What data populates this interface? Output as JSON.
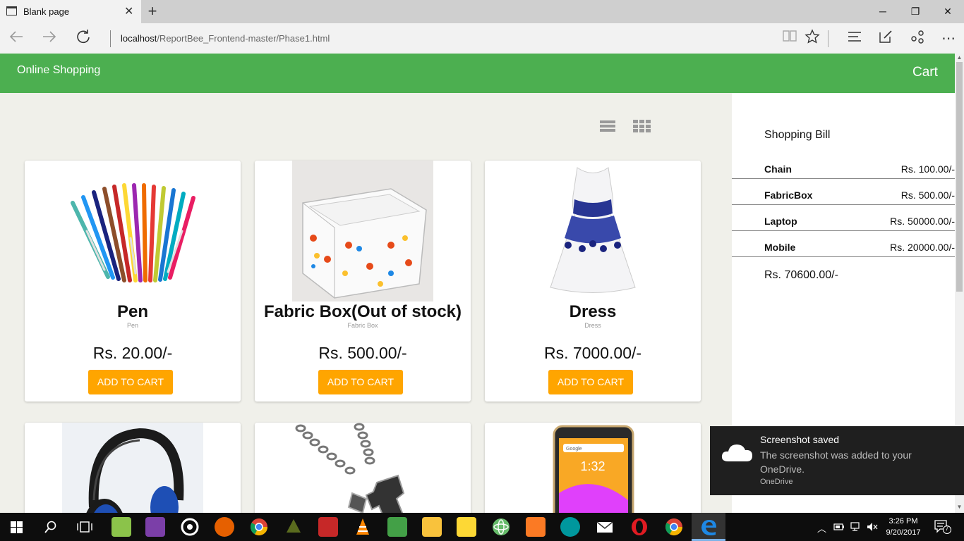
{
  "browser": {
    "tab_title": "Blank page",
    "tab_close": "✕",
    "new_tab": "+",
    "url_host": "localhost",
    "url_path": "/ReportBee_Frontend-master/Phase1.html",
    "minimize": "─",
    "restore": "❐",
    "close": "✕"
  },
  "navbar": {
    "brand": "Online Shopping",
    "cart": "Cart"
  },
  "view_toggle": {
    "list_icon": "list-view-icon",
    "grid_icon": "grid-view-icon"
  },
  "products": [
    {
      "name": "Pen",
      "desc": "Pen",
      "price": "Rs. 20.00/-",
      "button": "ADD TO CART"
    },
    {
      "name": "Fabric Box(Out of stock)",
      "desc": "Fabric Box",
      "price": "Rs. 500.00/-",
      "button": "ADD TO CART"
    },
    {
      "name": "Dress",
      "desc": "Dress",
      "price": "Rs. 7000.00/-",
      "button": "ADD TO CART"
    },
    {
      "name": "",
      "desc": "",
      "price": "",
      "button": ""
    },
    {
      "name": "",
      "desc": "",
      "price": "",
      "button": ""
    },
    {
      "name": "",
      "desc": "",
      "price": "",
      "button": ""
    }
  ],
  "phone_screen": {
    "search": "Google",
    "time": "1:32"
  },
  "bill": {
    "title": "Shopping Bill",
    "items": [
      {
        "name": "Chain",
        "amount": "Rs. 100.00/-"
      },
      {
        "name": "FabricBox",
        "amount": "Rs. 500.00/-"
      },
      {
        "name": "Laptop",
        "amount": "Rs. 50000.00/-"
      },
      {
        "name": "Mobile",
        "amount": "Rs. 20000.00/-"
      }
    ],
    "total": "Rs. 70600.00/-"
  },
  "toast": {
    "title": "Screenshot saved",
    "body": "The screenshot was added to your OneDrive.",
    "source": "OneDrive"
  },
  "taskbar": {
    "time": "3:26 PM",
    "date": "9/20/2017",
    "notifications": "7",
    "colors": {
      "android": "#8bc34a",
      "vs": "#7b3fa8",
      "firefox": "#e66000",
      "chrome": "#4285f4",
      "vlc": "#ff8800",
      "opera": "#e01b22",
      "edge": "#1e88e5"
    }
  }
}
